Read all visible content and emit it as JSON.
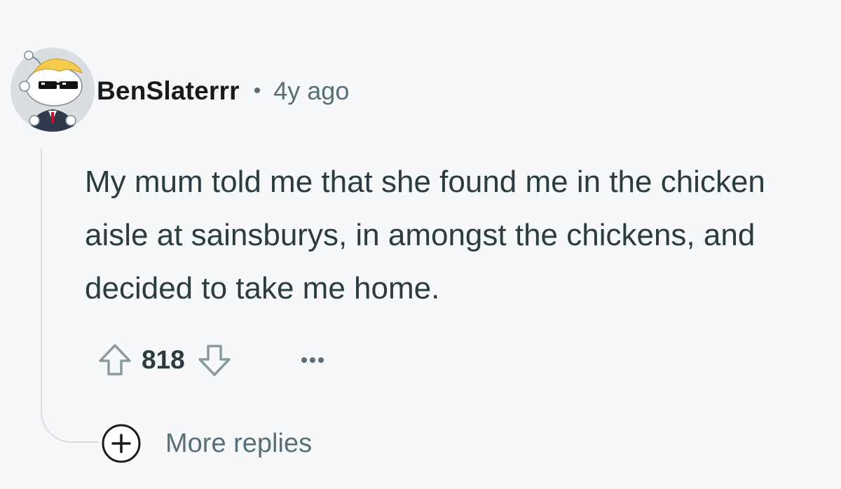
{
  "comment": {
    "author": "BenSlaterrr",
    "separator": "•",
    "timestamp": "4y ago",
    "avatar_icon": "snoo-avatar-icon",
    "body": "My mum told me that she found me in the chicken aisle at sainsburys, in amongst the chickens, and decided to take me home.",
    "score": "818",
    "more_replies_label": "More replies"
  },
  "icons": {
    "upvote": "arrow-up-icon",
    "downvote": "arrow-down-icon",
    "overflow": "ellipsis-icon",
    "expand": "plus-circle-icon"
  },
  "colors": {
    "background": "#f7f8fa",
    "text_primary": "#1a1a1b",
    "text_body": "#2a3c42",
    "text_secondary": "#576f76",
    "thread_line": "#d9dde0",
    "avatar_hair": "#f2cc4a"
  }
}
